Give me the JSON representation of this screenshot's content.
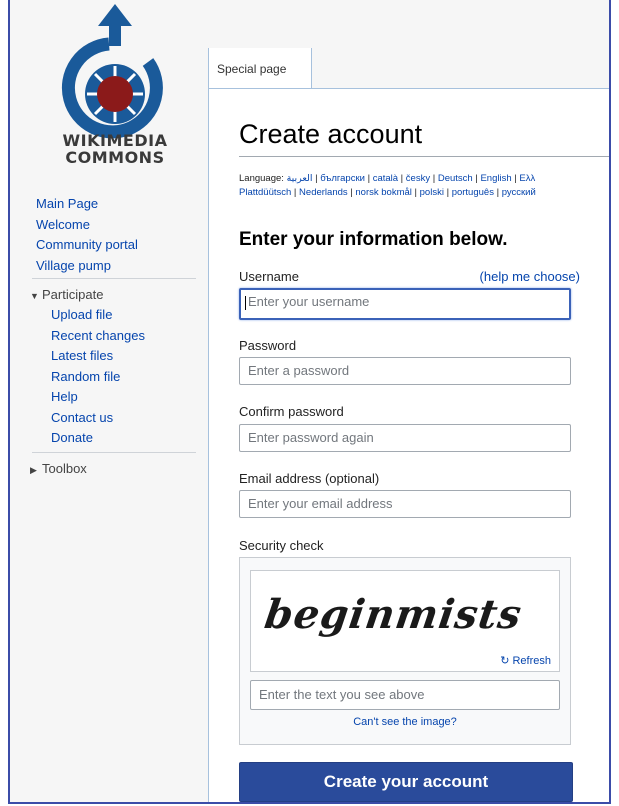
{
  "logo": {
    "line1": "WIKIMEDIA",
    "line2": "COMMONS"
  },
  "nav": {
    "main": [
      "Main Page",
      "Welcome",
      "Community portal",
      "Village pump"
    ],
    "participate": {
      "label": "Participate",
      "items": [
        "Upload file",
        "Recent changes",
        "Latest files",
        "Random file",
        "Help",
        "Contact us",
        "Donate"
      ]
    },
    "toolbox": "Toolbox"
  },
  "tab": "Special page",
  "page_title": "Create account",
  "languages": {
    "label": "Language:",
    "line1": [
      "العربية",
      "български",
      "català",
      "česky",
      "Deutsch",
      "English",
      "Ελλ"
    ],
    "line2": [
      "Plattdüütsch",
      "Nederlands",
      "norsk bokmål",
      "polski",
      "português",
      "русский"
    ]
  },
  "form": {
    "heading": "Enter your information below.",
    "username": {
      "label": "Username",
      "help": "(help me choose)",
      "placeholder": "Enter your username"
    },
    "password": {
      "label": "Password",
      "placeholder": "Enter a password"
    },
    "confirm": {
      "label": "Confirm password",
      "placeholder": "Enter password again"
    },
    "email": {
      "label": "Email address (optional)",
      "placeholder": "Enter your email address"
    },
    "security": {
      "label": "Security check",
      "captcha_word": "beginmists",
      "refresh": "Refresh",
      "placeholder": "Enter the text you see above",
      "cant_see": "Can't see the image?"
    },
    "submit": "Create your account"
  },
  "colors": {
    "frame": "#3b4ca8",
    "link": "#0645ad",
    "button": "#2a4b9b",
    "logo_blue": "#1a5a9a",
    "logo_red": "#8b1a1a"
  }
}
